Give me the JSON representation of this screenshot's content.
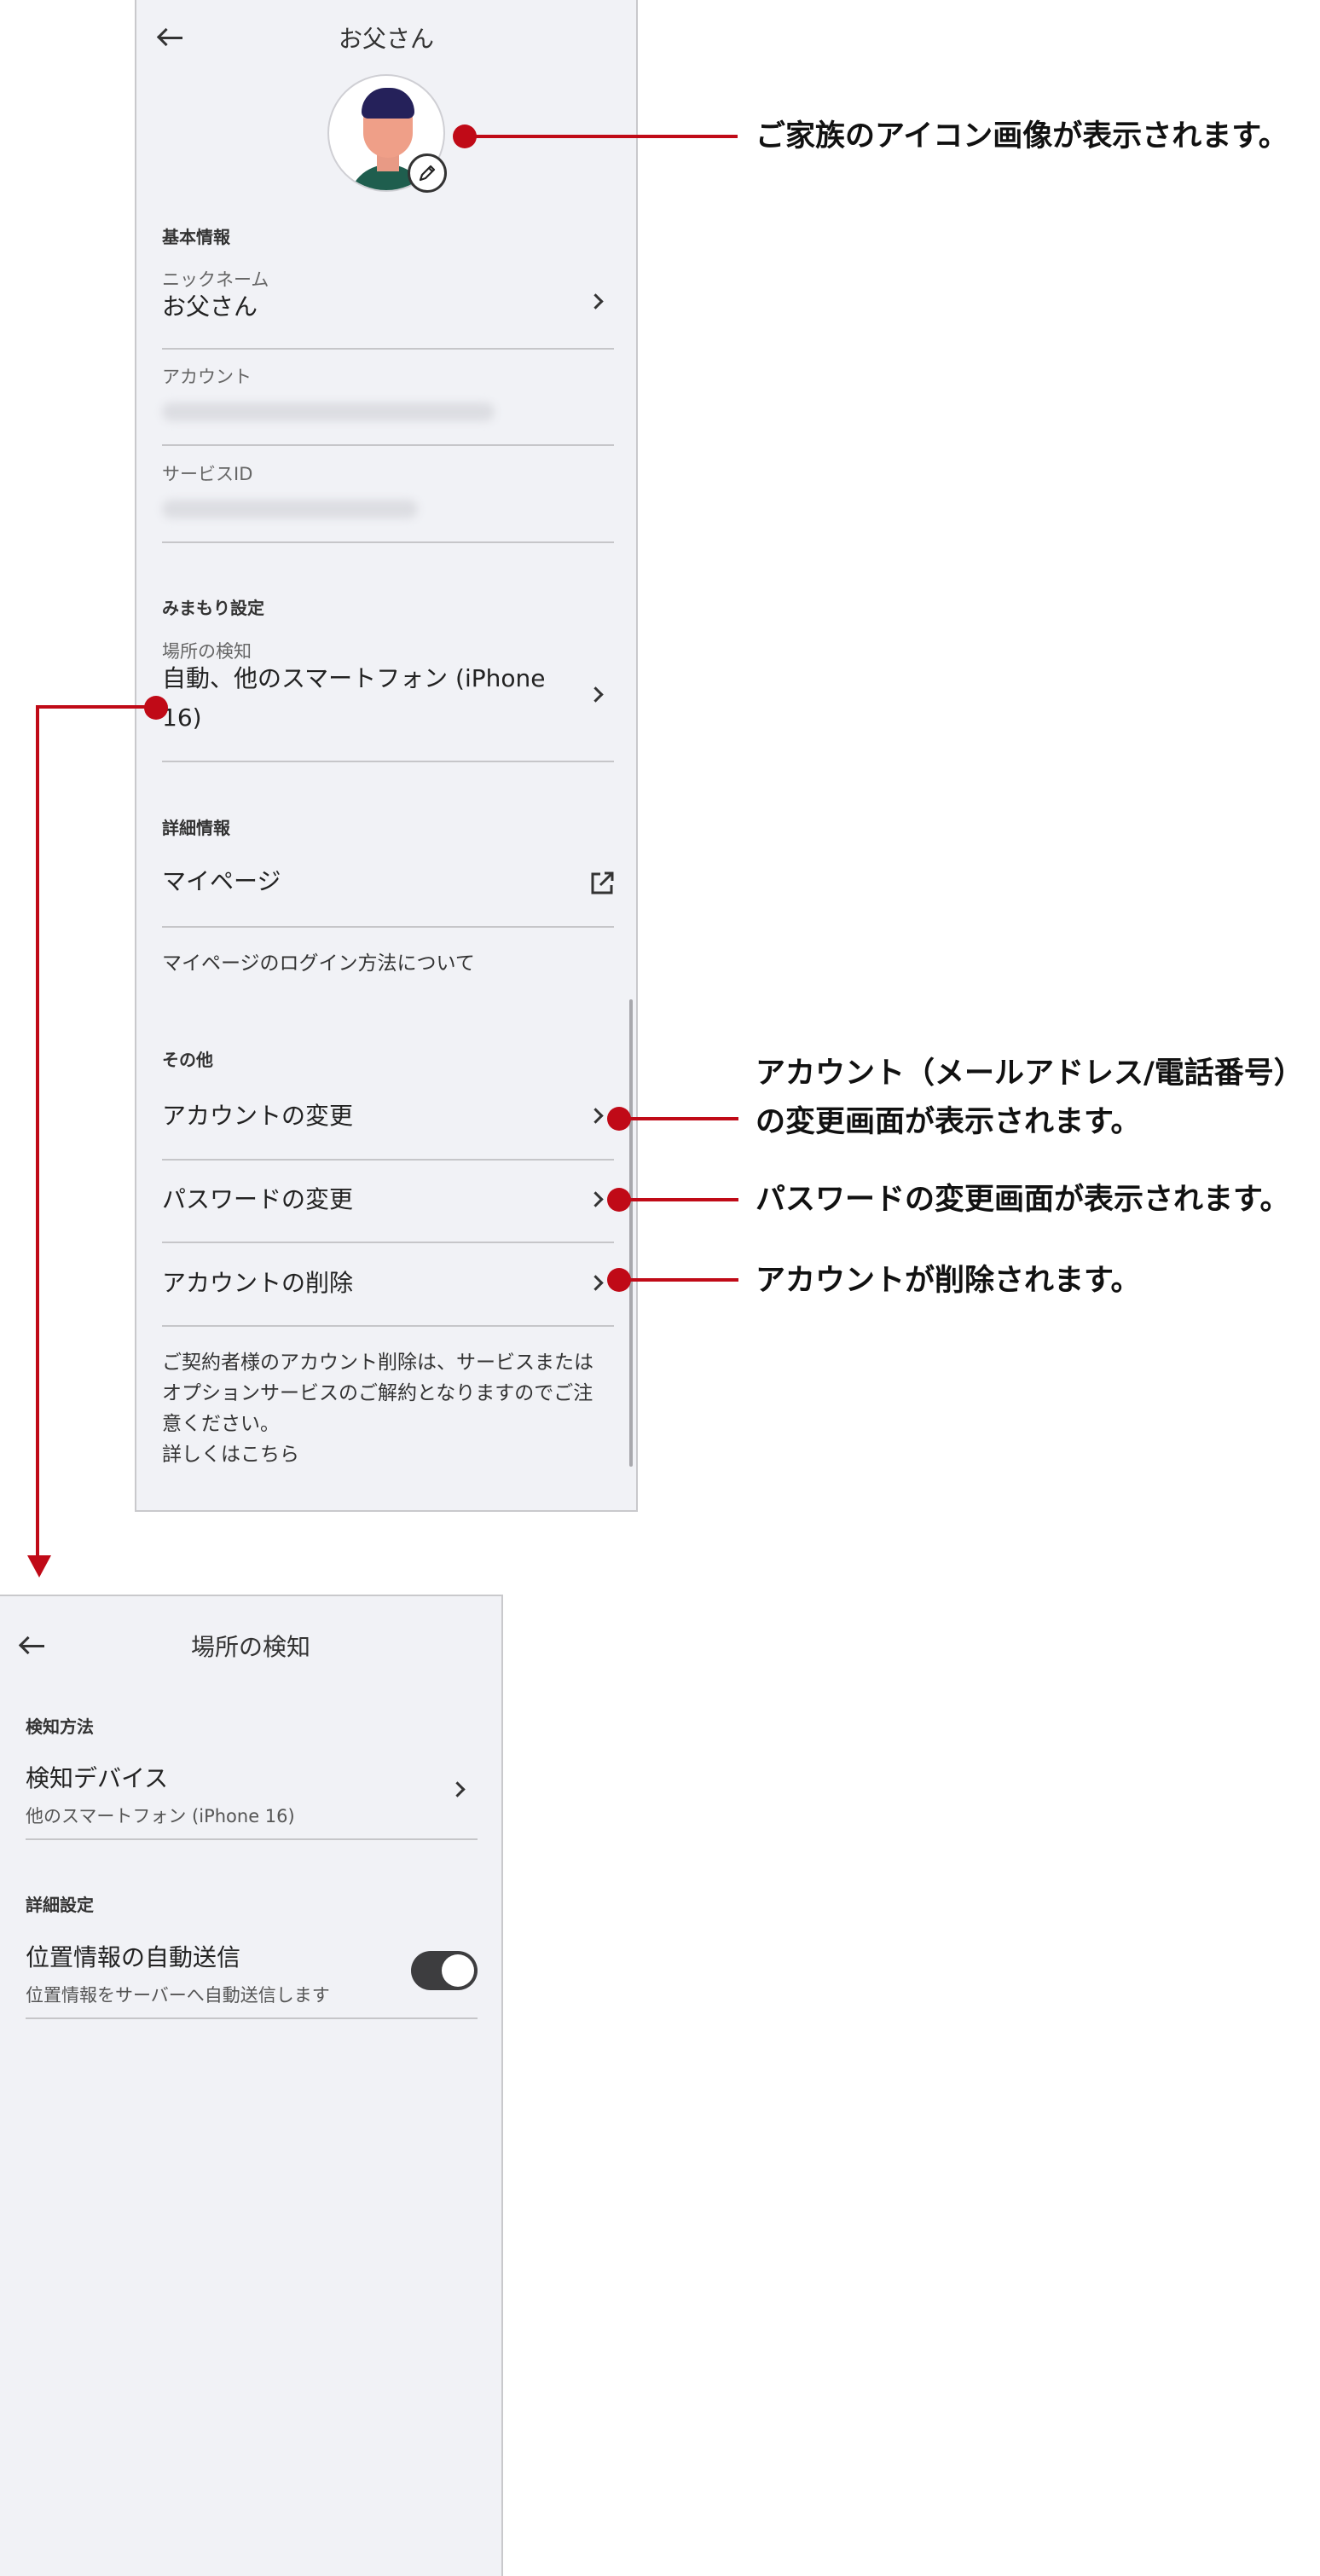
{
  "profile": {
    "title": "お父さん",
    "basic": {
      "heading": "基本情報",
      "nickname_label": "ニックネーム",
      "nickname_value": "お父さん",
      "account_label": "アカウント",
      "service_id_label": "サービスID"
    },
    "watch": {
      "heading": "みまもり設定",
      "location_label": "場所の検知",
      "location_value_1": "自動、他のスマートフォン (iPhone",
      "location_value_2": "16)"
    },
    "detail": {
      "heading": "詳細情報",
      "mypage": "マイページ",
      "mypage_login": "マイページのログイン方法について"
    },
    "other": {
      "heading": "その他",
      "change_account": "アカウントの変更",
      "change_password": "パスワードの変更",
      "delete_account": "アカウントの削除",
      "note_1": "ご契約者様のアカウント削除は、サービスまたは",
      "note_2": "オプションサービスのご解約となりますのでご注",
      "note_3": "意ください。",
      "note_link": "詳しくはこちら"
    }
  },
  "location_screen": {
    "title": "場所の検知",
    "method_heading": "検知方法",
    "device_label": "検知デバイス",
    "device_value": "他のスマートフォン (iPhone 16)",
    "detail_heading": "詳細設定",
    "auto_send_label": "位置情報の自動送信",
    "auto_send_desc": "位置情報をサーバーへ自動送信します",
    "auto_send_enabled": true
  },
  "callouts": {
    "avatar": "ご家族のアイコン画像が表示されます。",
    "account_1": "アカウント（メールアドレス/電話番号）",
    "account_2": "の変更画面が表示されます。",
    "password": "パスワードの変更画面が表示されます。",
    "delete": "アカウントが削除されます。"
  },
  "colors": {
    "accent_red": "#c00a17",
    "panel_bg": "#f1f2f6",
    "toggle_on": "#3d3d3f"
  },
  "icons": [
    "back-arrow-icon",
    "pencil-icon",
    "chevron-right-icon",
    "external-link-icon"
  ]
}
